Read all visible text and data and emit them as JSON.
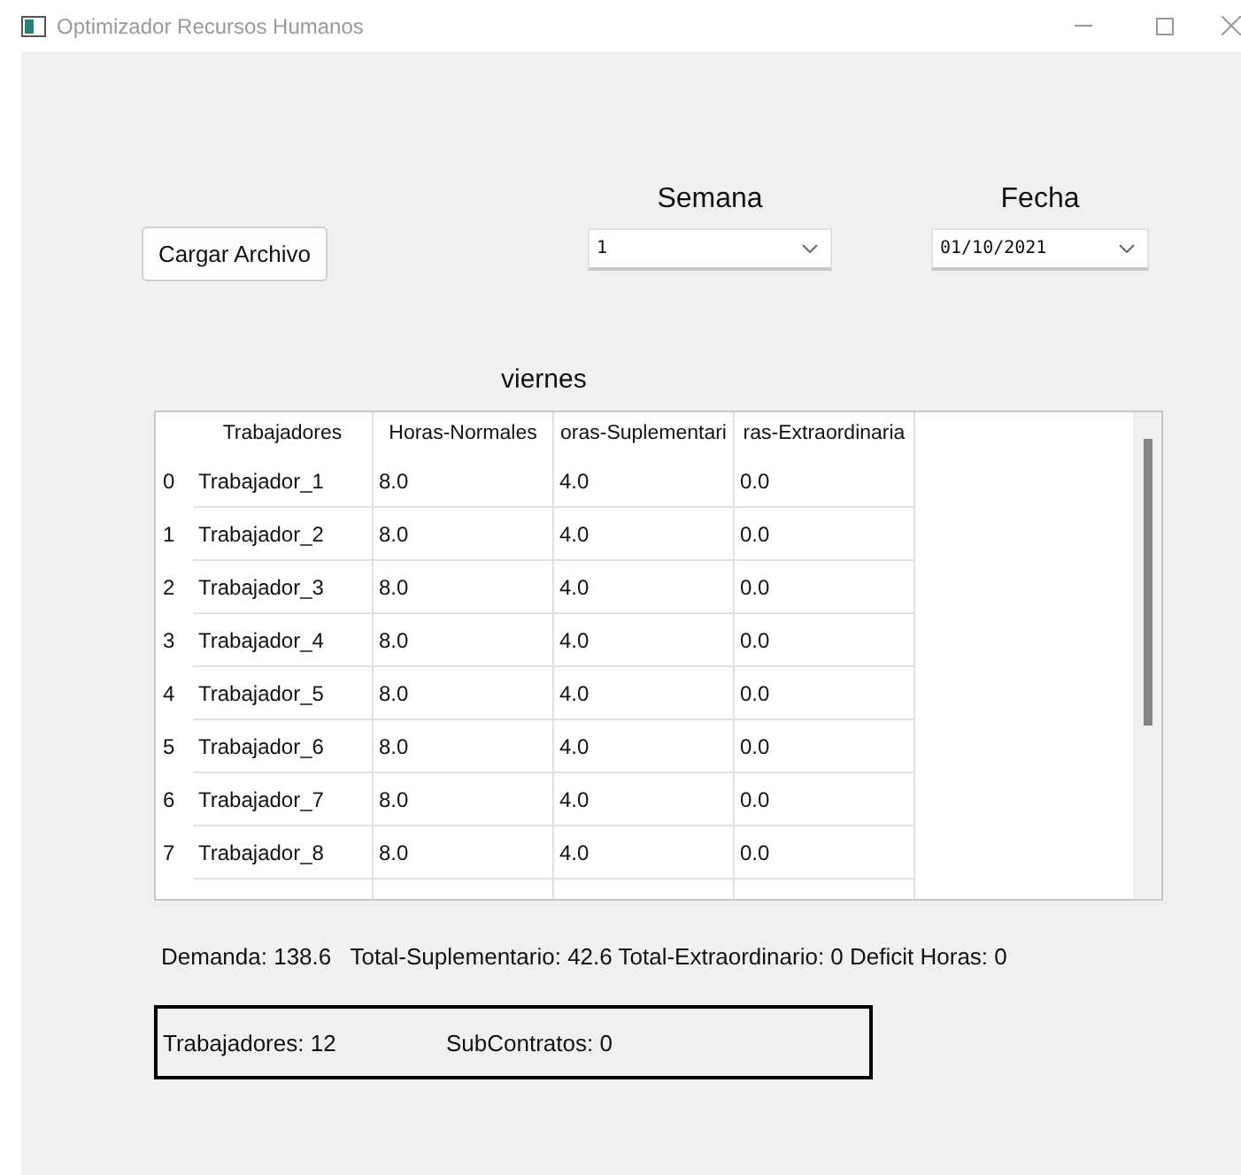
{
  "window": {
    "title": "Optimizador Recursos Humanos"
  },
  "load_button": {
    "label": "Cargar Archivo"
  },
  "semana": {
    "label": "Semana",
    "value": "1"
  },
  "fecha": {
    "label": "Fecha",
    "value": "01/10/2021"
  },
  "day_label": "viernes",
  "table": {
    "columns": [
      "Trabajadores",
      "Horas-Normales",
      "oras-Suplementari",
      "ras-Extraordinaria"
    ],
    "rows": [
      {
        "index": "0",
        "cells": [
          "Trabajador_1",
          "8.0",
          "4.0",
          "0.0"
        ]
      },
      {
        "index": "1",
        "cells": [
          "Trabajador_2",
          "8.0",
          "4.0",
          "0.0"
        ]
      },
      {
        "index": "2",
        "cells": [
          "Trabajador_3",
          "8.0",
          "4.0",
          "0.0"
        ]
      },
      {
        "index": "3",
        "cells": [
          "Trabajador_4",
          "8.0",
          "4.0",
          "0.0"
        ]
      },
      {
        "index": "4",
        "cells": [
          "Trabajador_5",
          "8.0",
          "4.0",
          "0.0"
        ]
      },
      {
        "index": "5",
        "cells": [
          "Trabajador_6",
          "8.0",
          "4.0",
          "0.0"
        ]
      },
      {
        "index": "6",
        "cells": [
          "Trabajador_7",
          "8.0",
          "4.0",
          "0.0"
        ]
      },
      {
        "index": "7",
        "cells": [
          "Trabajador_8",
          "8.0",
          "4.0",
          "0.0"
        ]
      }
    ]
  },
  "summary": "Demanda: 138.6   Total-Suplementario: 42.6 Total-Extraordinario: 0 Deficit Horas: 0",
  "counts": [
    "Trabajadores: 12",
    "SubContratos: 0"
  ]
}
